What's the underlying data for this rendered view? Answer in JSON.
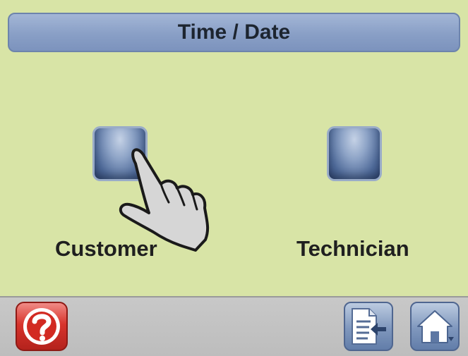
{
  "header": {
    "title": "Time / Date"
  },
  "options": [
    {
      "label": "Customer",
      "icon": "hand-pointer-icon"
    },
    {
      "label": "Technician"
    }
  ],
  "footer": {
    "help_icon": "question-mark-icon",
    "back_icon": "document-back-icon",
    "home_icon": "home-icon"
  },
  "colors": {
    "screen_background": "#d8e4a6",
    "title_bar": "#899fc6",
    "option_button": "#4d6897",
    "help_button": "#d8342c",
    "nav_button": "#7f97bd",
    "bottom_bar": "#c4c4c4"
  }
}
